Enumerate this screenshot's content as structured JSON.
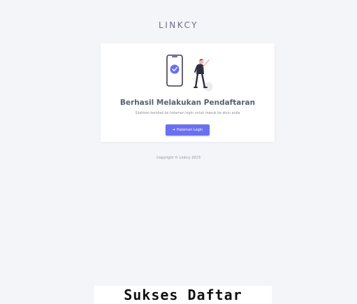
{
  "brand": {
    "name": "LINKCY"
  },
  "card": {
    "illustration": "phone-checkmark-person-illustration",
    "title": "Berhasil Melakukan Pendaftaran",
    "subtitle": "Silahkan kembali ke halaman login untuk masuk ke akun anda",
    "login_button": {
      "icon": "sign-in-icon",
      "label": "Halaman Login"
    }
  },
  "footer": {
    "copyright": "Copyright © Linkcy 2023"
  },
  "caption": {
    "text": "Sukses Daftar"
  },
  "colors": {
    "background": "#f4f5f8",
    "card": "#ffffff",
    "accent": "#6b6ff0",
    "text": "#5a6072"
  }
}
